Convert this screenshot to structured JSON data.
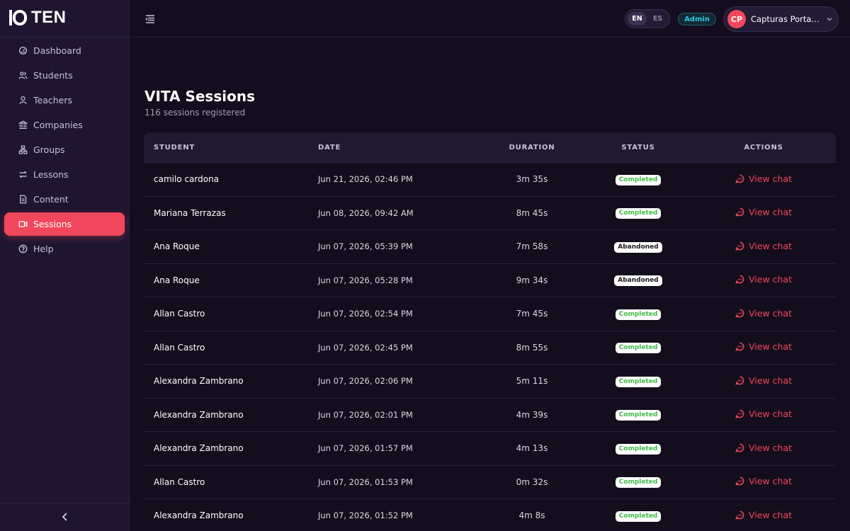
{
  "brand": {
    "name": "TEN"
  },
  "sidebar": {
    "items": [
      {
        "label": "Dashboard",
        "icon": "dashboard-icon",
        "active": false
      },
      {
        "label": "Students",
        "icon": "students-icon",
        "active": false
      },
      {
        "label": "Teachers",
        "icon": "teacher-icon",
        "active": false
      },
      {
        "label": "Companies",
        "icon": "building-icon",
        "active": false
      },
      {
        "label": "Groups",
        "icon": "groups-icon",
        "active": false
      },
      {
        "label": "Lessons",
        "icon": "lessons-icon",
        "active": false
      },
      {
        "label": "Content",
        "icon": "document-icon",
        "active": false
      },
      {
        "label": "Sessions",
        "icon": "video-icon",
        "active": true
      },
      {
        "label": "Help",
        "icon": "help-icon",
        "active": false
      }
    ]
  },
  "header": {
    "lang": {
      "en": "EN",
      "es": "ES",
      "selected": "EN"
    },
    "role": "Admin",
    "user": {
      "initials": "CP",
      "name": "Capturas Portafolio"
    }
  },
  "page": {
    "title": "VITA Sessions",
    "subtitle": "116 sessions registered"
  },
  "table": {
    "headers": {
      "student": "STUDENT",
      "date": "DATE",
      "duration": "DURATION",
      "status": "STATUS",
      "actions": "ACTIONS"
    },
    "rows": [
      {
        "student": "camilo cardona",
        "date": "Jun 21, 2026, 02:46 PM",
        "duration": "3m 35s",
        "status": "Completed",
        "action": "View chat"
      },
      {
        "student": "Mariana Terrazas",
        "date": "Jun 08, 2026, 09:42 AM",
        "duration": "8m 45s",
        "status": "Completed",
        "action": "View chat"
      },
      {
        "student": "Ana Roque",
        "date": "Jun 07, 2026, 05:39 PM",
        "duration": "7m 58s",
        "status": "Abandoned",
        "action": "View chat"
      },
      {
        "student": "Ana Roque",
        "date": "Jun 07, 2026, 05:28 PM",
        "duration": "9m 34s",
        "status": "Abandoned",
        "action": "View chat"
      },
      {
        "student": "Allan Castro",
        "date": "Jun 07, 2026, 02:54 PM",
        "duration": "7m 45s",
        "status": "Completed",
        "action": "View chat"
      },
      {
        "student": "Allan Castro",
        "date": "Jun 07, 2026, 02:45 PM",
        "duration": "8m 55s",
        "status": "Completed",
        "action": "View chat"
      },
      {
        "student": "Alexandra Zambrano",
        "date": "Jun 07, 2026, 02:06 PM",
        "duration": "5m 11s",
        "status": "Completed",
        "action": "View chat"
      },
      {
        "student": "Alexandra Zambrano",
        "date": "Jun 07, 2026, 02:01 PM",
        "duration": "4m 39s",
        "status": "Completed",
        "action": "View chat"
      },
      {
        "student": "Alexandra Zambrano",
        "date": "Jun 07, 2026, 01:57 PM",
        "duration": "4m 13s",
        "status": "Completed",
        "action": "View chat"
      },
      {
        "student": "Allan Castro",
        "date": "Jun 07, 2026, 01:53 PM",
        "duration": "0m 32s",
        "status": "Completed",
        "action": "View chat"
      },
      {
        "student": "Alexandra Zambrano",
        "date": "Jun 07, 2026, 01:52 PM",
        "duration": "4m 8s",
        "status": "Completed",
        "action": "View chat"
      }
    ]
  },
  "colors": {
    "accent": "#f1475c",
    "sidebar_bg": "#1f1530",
    "page_bg": "#130d1d",
    "completed": "#46b84a",
    "role": "#35c4e0"
  }
}
